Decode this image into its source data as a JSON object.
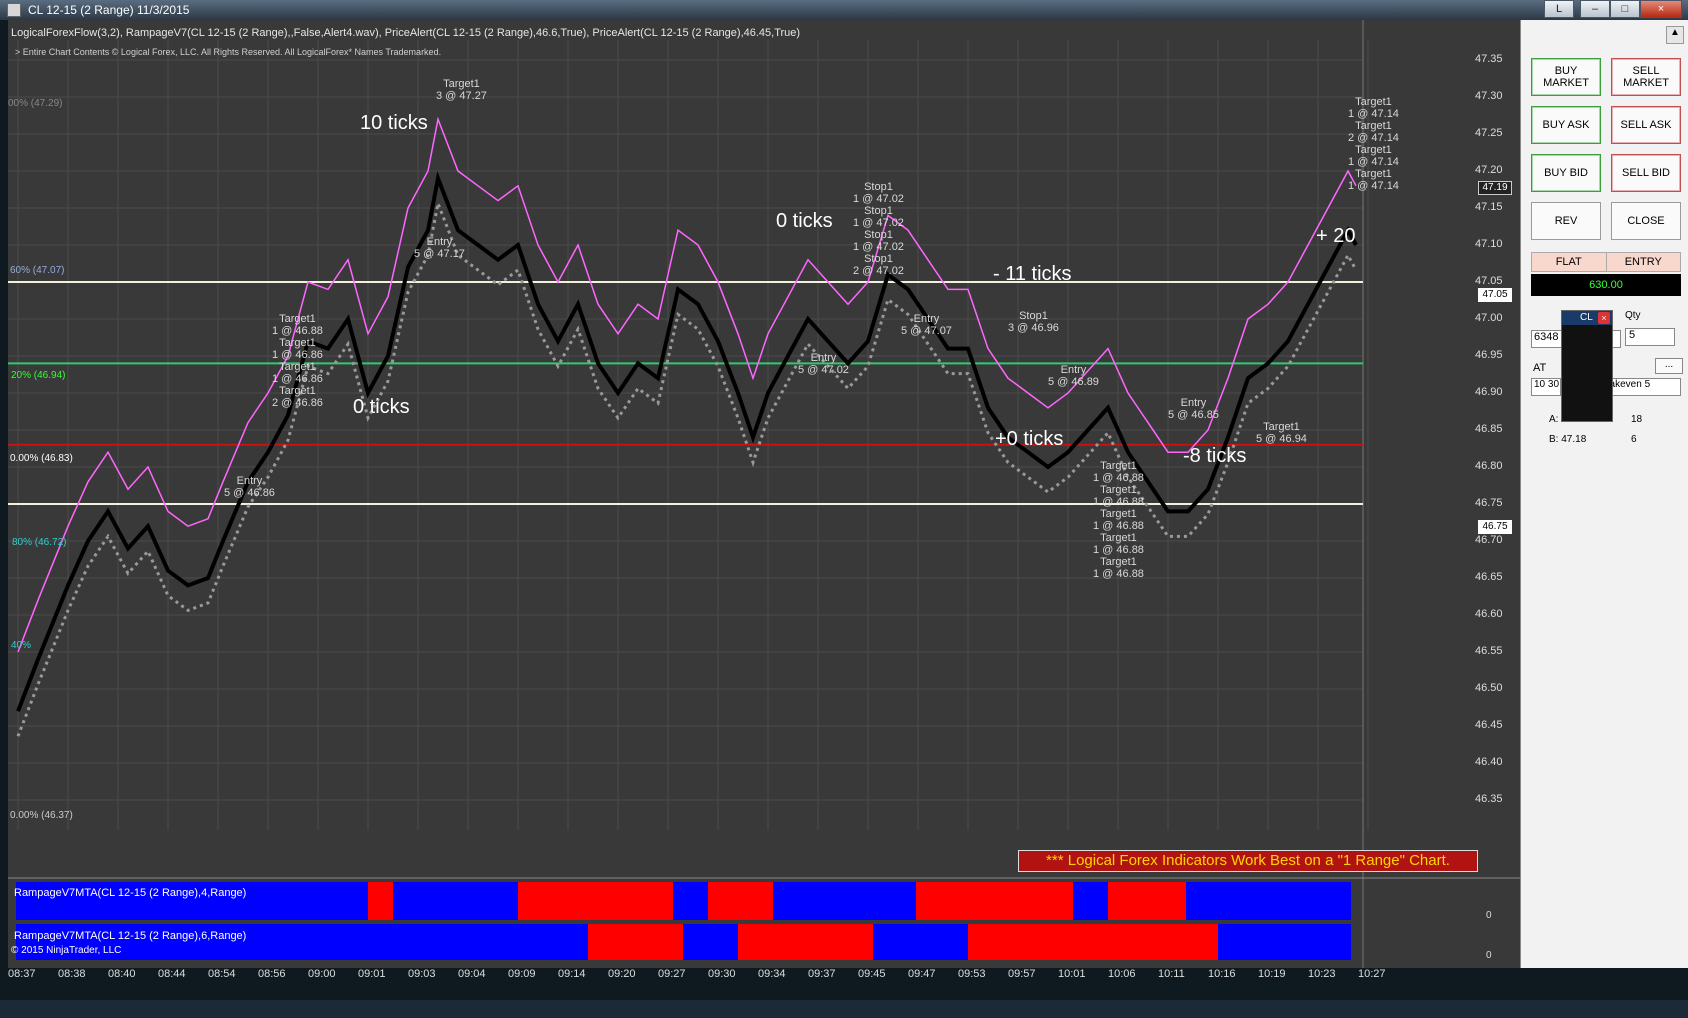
{
  "window": {
    "title": "CL 12-15 (2 Range)  11/3/2015",
    "btn_l": "L",
    "btn_min": "–",
    "btn_max": "□",
    "btn_close": "×"
  },
  "chart": {
    "indicators": "LogicalForexFlow(3,2),  RampageV7(CL 12-15 (2 Range),,False,Alert4.wav), PriceAlert(CL 12-15 (2 Range),46.6,True), PriceAlert(CL 12-15 (2 Range),46.45,True)",
    "copyright": "> Entire Chart Contents © Logical Forex, LLC. All Rights Reserved. All LogicalForex* Names Trademarked.",
    "banner": "*** Logical Forex Indicators Work Best on a \"1 Range\" Chart.",
    "sub1": "RampageV7MTA(CL 12-15 (2 Range),4,Range)",
    "sub2": "RampageV7MTA(CL 12-15 (2 Range),6,Range)",
    "nt_copy": "© 2015 NinjaTrader, LLC",
    "sub_zero": "0",
    "price_ticks": [
      "47.35",
      "47.30",
      "47.25",
      "47.20",
      "47.15",
      "47.10",
      "47.05",
      "47.00",
      "46.95",
      "46.90",
      "46.85",
      "46.80",
      "46.75",
      "46.70",
      "46.65",
      "46.60",
      "46.55",
      "46.50",
      "46.45",
      "46.40",
      "46.35"
    ],
    "price_tags": {
      "last": "47.19",
      "white1": "47.05",
      "white2": "46.75"
    },
    "time_ticks": [
      "08:37",
      "08:38",
      "08:40",
      "08:44",
      "08:54",
      "08:56",
      "09:00",
      "09:01",
      "09:03",
      "09:04",
      "09:09",
      "09:14",
      "09:20",
      "09:27",
      "09:30",
      "09:34",
      "09:37",
      "09:45",
      "09:47",
      "09:53",
      "09:57",
      "10:01",
      "10:06",
      "10:11",
      "10:16",
      "10:19",
      "10:23",
      "10:27"
    ],
    "fib": {
      "f100": "00% (47.29)",
      "f60": "60% (47.07)",
      "f20": "20% (46.94)",
      "f00b": "0.00% (46.83)",
      "f80": "80% (46.72)",
      "f40": "40%",
      "f0": "0.00% (46.37)"
    },
    "notes": {
      "n10": "10 ticks",
      "n0a": "0 ticks",
      "n0b": "0 ticks",
      "n11": "- 11 ticks",
      "n0c": "+0 ticks",
      "n8": "-8 ticks",
      "n20": "+ 20"
    },
    "labels": {
      "t1": "Target1\n3 @ 47.27",
      "e1": "Entry\n5 @ 47.17",
      "t2": "Target1\n1 @ 46.88\nTarget1\n1 @ 46.86\nTarget1\n1 @ 46.86\nTarget1\n2 @ 46.86",
      "e2": "Entry\n5 @ 46.86",
      "s1": "Stop1\n1 @ 47.02\nStop1\n1 @ 47.02\nStop1\n1 @ 47.02\nStop1\n2 @ 47.02",
      "e3": "Entry\n5 @ 47.02",
      "e4": "Entry\n5 @ 47.07",
      "s2": "Stop1\n3 @ 46.96",
      "e5": "Entry\n5 @ 46.89",
      "t3": "Target1\n1 @ 46.88\nTarget1\n1 @ 46.88\nTarget1\n1 @ 46.88\nTarget1\n1 @ 46.88\nTarget1\n1 @ 46.88",
      "e6": "Entry\n5 @ 46.85",
      "e7": "Target1\n5 @ 46.94",
      "t4": "Target1\n1 @ 47.14\nTarget1\n2 @ 47.14\nTarget1\n1 @ 47.14\nTarget1\n1 @ 47.14"
    }
  },
  "panel": {
    "buy_market": "BUY\nMARKET",
    "sell_market": "SELL\nMARKET",
    "buy_ask": "BUY ASK",
    "sell_ask": "SELL ASK",
    "buy_bid": "BUY BID",
    "sell_bid": "SELL BID",
    "rev": "REV",
    "close": "CLOSE",
    "flat": "FLAT",
    "entry": "ENTRY",
    "pnl": "630.00",
    "qty_label": "Qty",
    "qty_value": "5",
    "account": "6348",
    "at": "AT",
    "atm": "10 30",
    "strategy": "eakeven 5",
    "ask": "A: 47.19",
    "ask_size": "18",
    "bid": "B: 47.18",
    "bid_size": "6",
    "instrument": "CL",
    "ellipsis": "..."
  },
  "colors": {
    "bg": "#393939",
    "up": "#0000ff",
    "down": "#ff0000",
    "price": "#ff66ff",
    "wave": "#1e2fb5"
  }
}
